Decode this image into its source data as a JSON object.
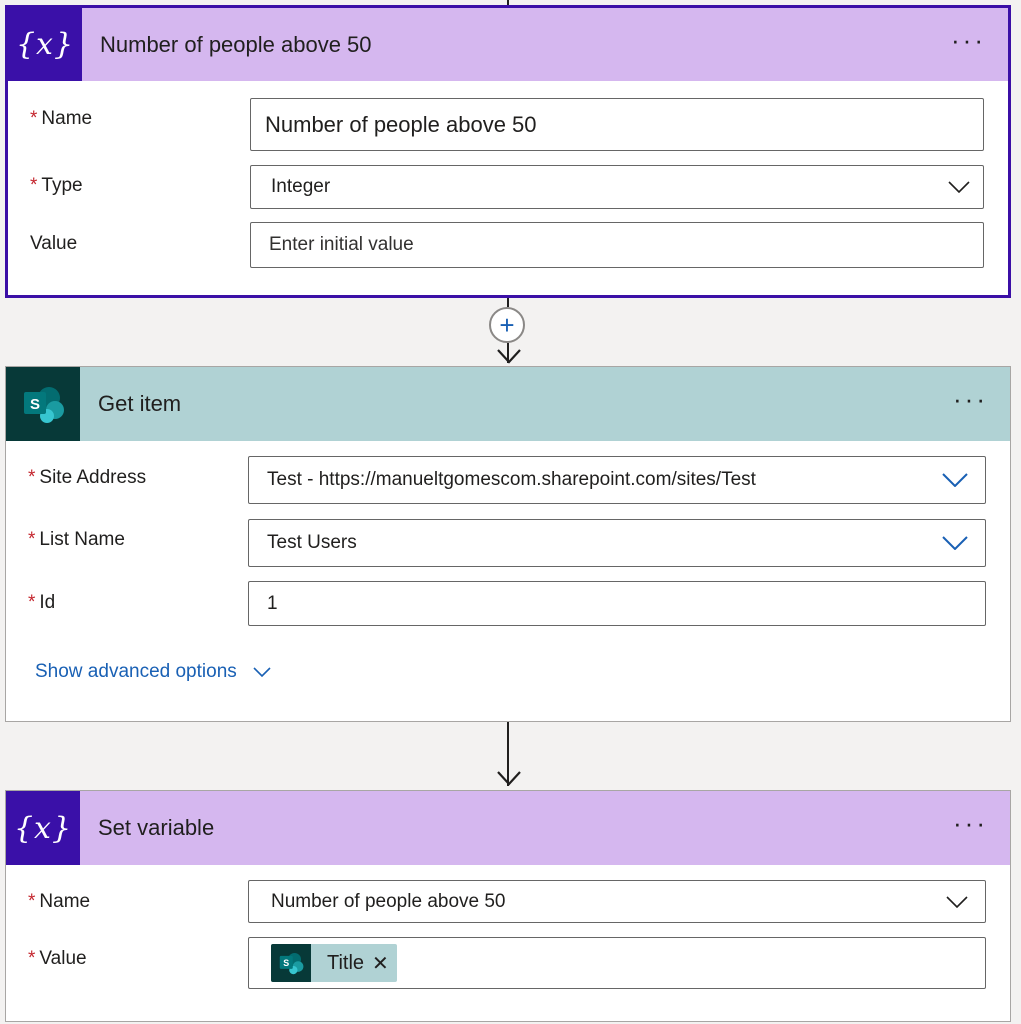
{
  "cards": {
    "init": {
      "title": "Number of people above 50",
      "icon_glyph": "{x}",
      "more_label": "···",
      "name_label": "Name",
      "name_value": "Number of people above 50",
      "type_label": "Type",
      "type_value": "Integer",
      "value_label": "Value",
      "value_placeholder": "Enter initial value"
    },
    "get_item": {
      "title": "Get item",
      "more_label": "···",
      "site_label": "Site Address",
      "site_value": "Test - https://manueltgomescom.sharepoint.com/sites/Test",
      "list_label": "List Name",
      "list_value": "Test Users",
      "id_label": "Id",
      "id_value": "1",
      "advanced_link": "Show advanced options"
    },
    "set_var": {
      "title": "Set variable",
      "icon_glyph": "{x}",
      "more_label": "···",
      "name_label": "Name",
      "name_value": "Number of people above 50",
      "value_label": "Value",
      "token_label": "Title",
      "token_remove": "✕"
    }
  },
  "required_marker": "*",
  "connector": {
    "plus_label": "+"
  },
  "colors": {
    "variable_header": "#d5b7ef",
    "variable_icon_bg": "#3a10a8",
    "sharepoint_header": "#b0d2d4",
    "sharepoint_icon_bg": "#073938",
    "link": "#1960b4",
    "required": "#c4262e"
  }
}
